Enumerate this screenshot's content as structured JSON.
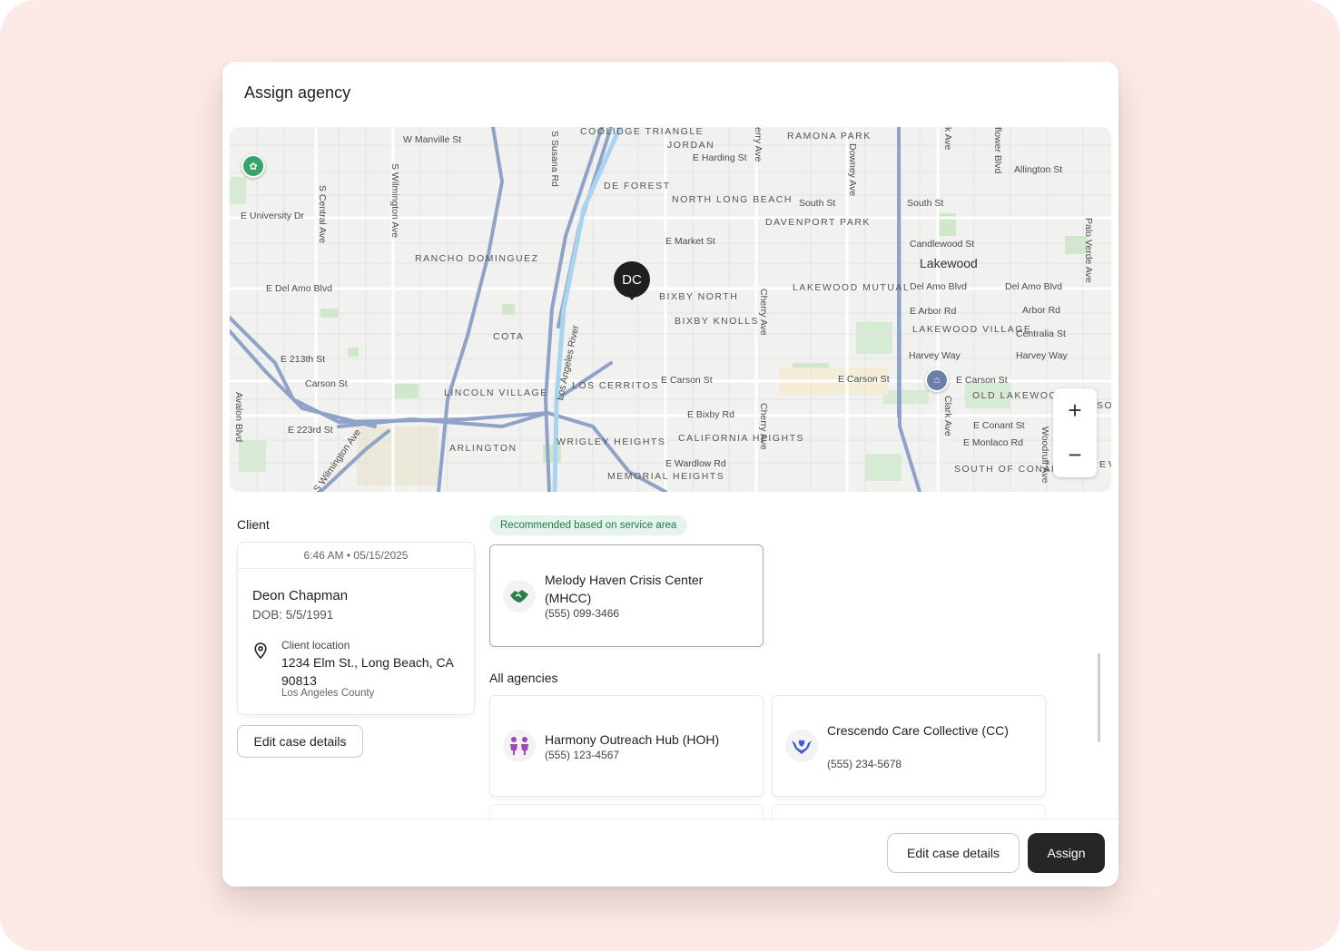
{
  "modal": {
    "title": "Assign agency"
  },
  "map": {
    "marker_initials": "DC",
    "zoom_in": "+",
    "zoom_out": "−",
    "labels": {
      "w_manville": "W Manville St",
      "coolidge": "COOLIDGE TRIANGLE",
      "jordan": "JORDAN",
      "e_harding": "E Harding St",
      "ramona": "RAMONA PARK",
      "allington": "Allington St",
      "de_forest": "DE FOREST",
      "north_long_beach": "NORTH LONG BEACH",
      "south_st_1": "South St",
      "south_st_2": "South St",
      "davenport": "DAVENPORT PARK",
      "e_university": "E University Dr",
      "e_market": "E Market St",
      "candlewood": "Candlewood St",
      "lakewood": "Lakewood",
      "rancho": "RANCHO DOMINGUEZ",
      "e_del_amo": "E Del Amo Blvd",
      "bixby_north": "BIXBY NORTH",
      "lakewood_mutual": "LAKEWOOD MUTUAL",
      "del_amo_1": "Del Amo Blvd",
      "del_amo_2": "Del Amo Blvd",
      "bixby_knolls": "BIXBY KNOLLS",
      "e_arbor": "E Arbor Rd",
      "arbor": "Arbor Rd",
      "lakewood_village": "LAKEWOOD VILLAGE",
      "centralia": "Centralia St",
      "cota": "COTA",
      "e_213th": "E 213th St",
      "harvey_1": "Harvey Way",
      "harvey_2": "Harvey Way",
      "carson": "Carson St",
      "los_cerritos": "LOS CERRITOS",
      "e_carson_1": "E Carson St",
      "e_carson_2": "E Carson St",
      "e_carson_3": "E Carson St",
      "lincoln_village": "LINCOLN VILLAGE",
      "old_lakewood": "OLD LAKEWOOD CITY",
      "so": "SO",
      "e_bixby": "E Bixby Rd",
      "e_conant": "E Conant St",
      "e_223rd": "E 223rd St",
      "arlington": "ARLINGTON",
      "wrigley": "WRIGLEY HEIGHTS",
      "california_heights": "CALIFORNIA HEIGHTS",
      "e_monlaco": "E Monlaco Rd",
      "e_wardlow": "E Wardlow Rd",
      "south_of_conant": "SOUTH OF CONANT",
      "memorial": "MEMORIAL HEIGHTS",
      "e_v": "E V",
      "s_susana": "S Susana Rd",
      "s_wilmington": "S Wilmington Ave",
      "s_central": "S Central Ave",
      "cherry_1": "erry Ave",
      "cherry_2": "Cherry Ave",
      "cherry_3": "Cherry Ave",
      "downey": "Downey Ave",
      "k_ave": "k Ave",
      "flower": "flower Blvd",
      "palo_verde": "Palo Verde Ave",
      "clark": "Clark Ave",
      "woodruff": "Woodruff Ave",
      "avalon": "Avalon Blvd",
      "la_river": "Los Angeles River",
      "s_wilmington_2": "S Wilmington Ave"
    }
  },
  "client": {
    "section_label": "Client",
    "timestamp": "6:46 AM • 05/15/2025",
    "name": "Deon Chapman",
    "dob": "DOB: 5/5/1991",
    "location_label": "Client location",
    "address": "1234 Elm St., Long Beach, CA 90813",
    "county": "Los Angeles County",
    "edit_button": "Edit case details"
  },
  "recommended": {
    "badge": "Recommended based on service area",
    "agency": {
      "name": "Melody Haven Crisis Center (MHCC)",
      "phone": "(555) 099-3466",
      "icon": "handshake-icon",
      "color": "#2e7d4a"
    }
  },
  "all_agencies": {
    "section_label": "All agencies",
    "items": [
      {
        "name": "Harmony Outreach Hub (HOH)",
        "phone": "(555) 123-4567",
        "icon": "people-icon",
        "color": "#a347b8"
      },
      {
        "name": "Crescendo Care Collective (CC)",
        "phone": "(555) 234-5678",
        "icon": "hands-heart-icon",
        "color": "#3f5bd4"
      }
    ]
  },
  "footer": {
    "edit_button": "Edit case details",
    "assign_button": "Assign"
  }
}
